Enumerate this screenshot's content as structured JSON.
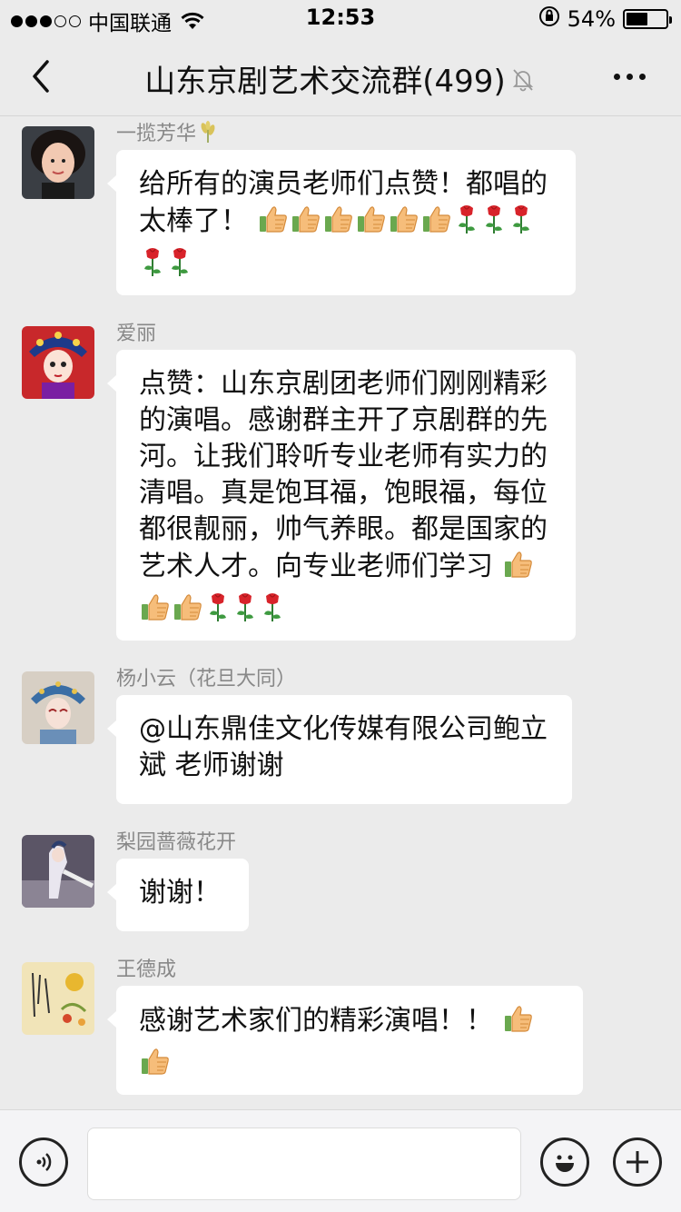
{
  "status_bar": {
    "carrier": "中国联通",
    "time": "12:53",
    "battery": "54%",
    "battery_level": 0.54
  },
  "nav": {
    "title": "山东京剧艺术交流群(499)",
    "back_icon": "chevron-left-icon",
    "mute_icon": "bell-off-icon",
    "more_icon": "more-dots-icon"
  },
  "messages": [
    {
      "sender": "一揽芳华",
      "text": "给所有的演员老师们点赞！都唱的太棒了！",
      "emoji": [
        "thumbs-up",
        "thumbs-up",
        "thumbs-up",
        "thumbs-up",
        "thumbs-up",
        "thumbs-up",
        "rose",
        "rose",
        "rose",
        "rose",
        "rose"
      ]
    },
    {
      "sender": "爱丽",
      "text": "点赞：山东京剧团老师们刚刚精彩的演唱。感谢群主开了京剧群的先河。让我们聆听专业老师有实力的清唱。真是饱耳福，饱眼福，每位都很靓丽，帅气养眼。都是国家的艺术人才。向专业老师们学习",
      "emoji": [
        "thumbs-up",
        "thumbs-up",
        "thumbs-up",
        "rose",
        "rose",
        "rose"
      ]
    },
    {
      "sender": "杨小云（花旦大同）",
      "text": "@山东鼎佳文化传媒有限公司鲍立斌 老师谢谢",
      "emoji": []
    },
    {
      "sender": "梨园蔷薇花开",
      "text": "谢谢！",
      "emoji": []
    },
    {
      "sender": "王德成",
      "text": "感谢艺术家们的精彩演唱！！",
      "emoji": [
        "thumbs-up",
        "thumbs-up"
      ]
    }
  ],
  "input": {
    "placeholder": "",
    "voice_icon": "voice-icon",
    "emoji_icon": "emoji-icon",
    "plus_icon": "plus-icon"
  }
}
